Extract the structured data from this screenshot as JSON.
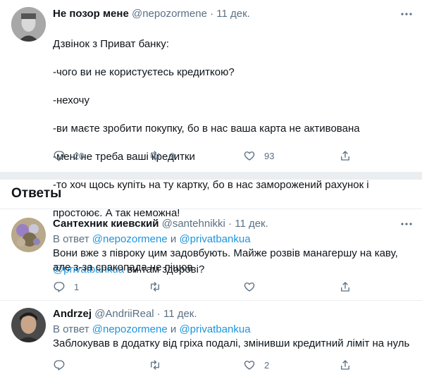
{
  "main_tweet": {
    "name": "Не позор мене",
    "handle": "@nepozormene",
    "time": "11 дек.",
    "lines": [
      "Дзвінок з Приват банку:",
      "-чого ви не користуєтесь кредиткою?",
      "-нехочу",
      "-ви маєте зробити покупку, бо в нас ваша карта не активована",
      "-мені не треба ваші кредитки",
      "-то хоч щось купіть на ту картку, бо в нас заморожений рахунок і",
      "простоює. А так неможна!"
    ],
    "mention": "@privatbankua",
    "mention_suffix": " ви там здорові?",
    "replies": "20",
    "retweets": "9",
    "likes": "93"
  },
  "section": {
    "title": "Ответы"
  },
  "reply1": {
    "name": "Сантехник киевский",
    "handle": "@santehnikki",
    "time": "11 дек.",
    "reply_prefix": "В ответ ",
    "mention1": "@nepozormene",
    "and": " и ",
    "mention2": "@privatbankua",
    "text": "Вони вже з півроку цим задовбують. Майже розвів манагершу на каву,\nале з-за сракопада не пішов",
    "replies": "1",
    "retweets": "",
    "likes": ""
  },
  "reply2": {
    "name": "Andrzej",
    "handle": "@AndriiReal",
    "time": "11 дек.",
    "reply_prefix": "В ответ ",
    "mention1": "@nepozormene",
    "and": " и ",
    "mention2": "@privatbankua",
    "text": "Заблокував в додатку від гріха подалі, змінивши кредитний ліміт на нуль",
    "replies": "",
    "retweets": "",
    "likes": "2"
  },
  "colors": {
    "link": "#1b95e0",
    "muted": "#5b7083",
    "text": "#0f1419",
    "separator": "#ebeef0"
  }
}
